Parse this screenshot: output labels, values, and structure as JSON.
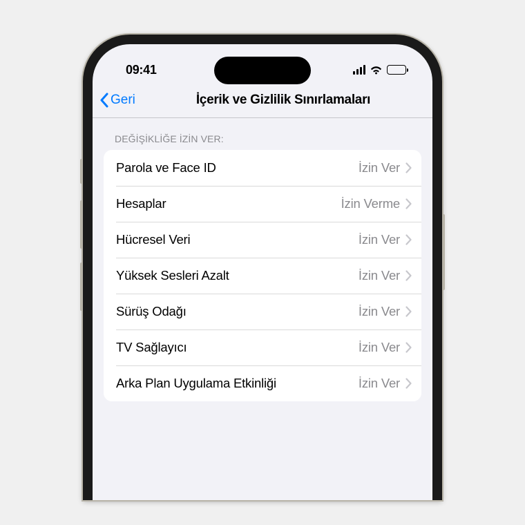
{
  "statusBar": {
    "time": "09:41"
  },
  "nav": {
    "back": "Geri",
    "title": "İçerik ve Gizlilik Sınırlamaları"
  },
  "section": {
    "header": "DEĞİŞİKLİĞE İZİN VER:"
  },
  "rows": [
    {
      "label": "Parola ve Face ID",
      "value": "İzin Ver"
    },
    {
      "label": "Hesaplar",
      "value": "İzin Verme"
    },
    {
      "label": "Hücresel Veri",
      "value": "İzin Ver"
    },
    {
      "label": "Yüksek Sesleri Azalt",
      "value": "İzin Ver"
    },
    {
      "label": "Sürüş Odağı",
      "value": "İzin Ver"
    },
    {
      "label": "TV Sağlayıcı",
      "value": "İzin Ver"
    },
    {
      "label": "Arka Plan Uygulama Etkinliği",
      "value": "İzin Ver"
    }
  ]
}
